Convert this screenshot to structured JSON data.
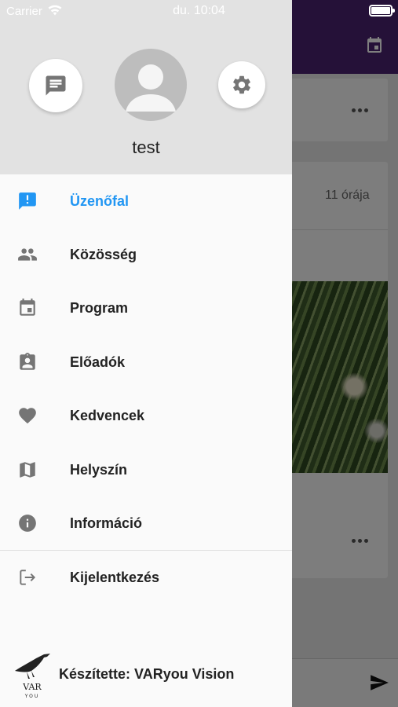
{
  "status_bar": {
    "carrier": "Carrier",
    "time": "du. 10:04"
  },
  "profile": {
    "username": "test"
  },
  "menu": [
    {
      "label": "Üzenőfal",
      "icon": "announcement-icon",
      "active": true
    },
    {
      "label": "Közösség",
      "icon": "people-icon",
      "active": false
    },
    {
      "label": "Program",
      "icon": "calendar-icon",
      "active": false
    },
    {
      "label": "Előadók",
      "icon": "speaker-badge-icon",
      "active": false
    },
    {
      "label": "Kedvencek",
      "icon": "heart-icon",
      "active": false
    },
    {
      "label": "Helyszín",
      "icon": "map-icon",
      "active": false
    },
    {
      "label": "Információ",
      "icon": "info-icon",
      "active": false
    }
  ],
  "logout": {
    "label": "Kijelentkezés",
    "icon": "logout-icon"
  },
  "footer": {
    "credit": "Készítette: VARyou Vision",
    "logo_text": "VAR YOU"
  },
  "background": {
    "post_time": "11 órája"
  },
  "colors": {
    "accent": "#2196f3",
    "appbar": "#4a2370",
    "icon_gray": "#757575"
  }
}
